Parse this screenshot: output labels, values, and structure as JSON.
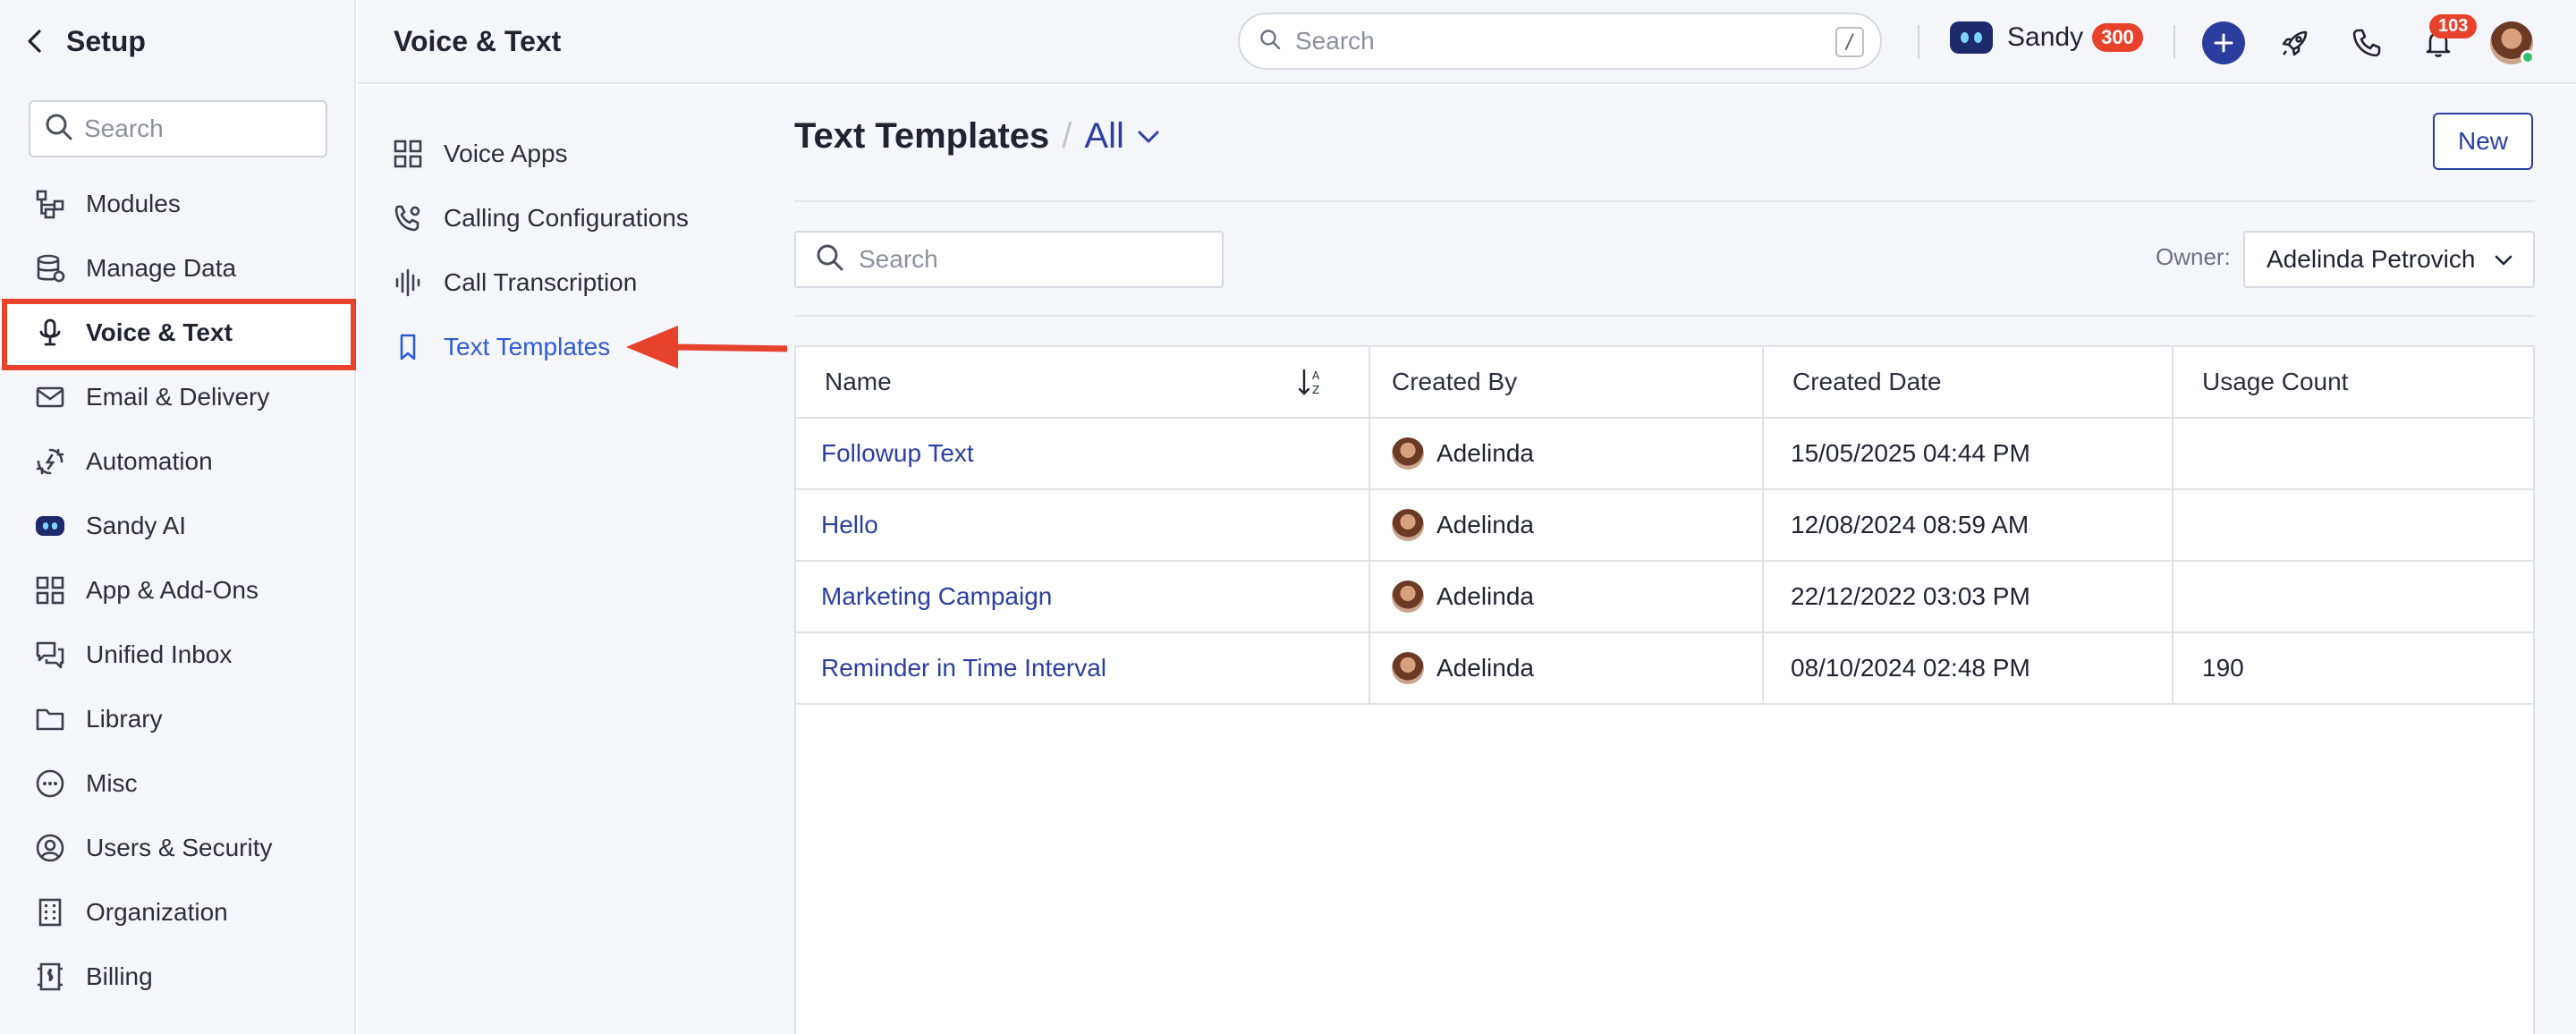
{
  "sidebar": {
    "title": "Setup",
    "search_placeholder": "Search",
    "items": [
      {
        "label": "Modules",
        "icon": "modules-icon"
      },
      {
        "label": "Manage Data",
        "icon": "database-icon"
      },
      {
        "label": "Voice & Text",
        "icon": "microphone-icon",
        "active": true
      },
      {
        "label": "Email & Delivery",
        "icon": "mail-icon"
      },
      {
        "label": "Automation",
        "icon": "automation-icon"
      },
      {
        "label": "Sandy AI",
        "icon": "bot-icon"
      },
      {
        "label": "App & Add-Ons",
        "icon": "grid-icon"
      },
      {
        "label": "Unified Inbox",
        "icon": "chat-icon"
      },
      {
        "label": "Library",
        "icon": "folder-icon"
      },
      {
        "label": "Misc",
        "icon": "ellipsis-icon"
      },
      {
        "label": "Users & Security",
        "icon": "user-circle-icon"
      },
      {
        "label": "Organization",
        "icon": "building-icon"
      },
      {
        "label": "Billing",
        "icon": "receipt-icon"
      }
    ]
  },
  "topbar": {
    "title": "Voice & Text",
    "search_placeholder": "Search",
    "search_shortcut": "/",
    "assistant_name": "Sandy",
    "assistant_credits": "300",
    "notification_count": "103"
  },
  "subnav": {
    "items": [
      {
        "label": "Voice Apps",
        "icon": "grid-icon"
      },
      {
        "label": "Calling Configurations",
        "icon": "phone-settings-icon"
      },
      {
        "label": "Call Transcription",
        "icon": "waveform-icon"
      },
      {
        "label": "Text Templates",
        "icon": "bookmark-icon",
        "active": true
      }
    ]
  },
  "main": {
    "title": "Text Templates",
    "separator": "/",
    "filter_value": "All",
    "new_label": "New",
    "search_placeholder": "Search",
    "owner_label": "Owner:",
    "owner_value": "Adelinda Petrovich",
    "table": {
      "columns": [
        "Name",
        "Created By",
        "Created Date",
        "Usage Count"
      ],
      "rows": [
        {
          "name": "Followup Text",
          "created_by": "Adelinda",
          "created_date": "15/05/2025 04:44 PM",
          "usage_count": ""
        },
        {
          "name": "Hello",
          "created_by": "Adelinda",
          "created_date": "12/08/2024 08:59 AM",
          "usage_count": ""
        },
        {
          "name": "Marketing Campaign",
          "created_by": "Adelinda",
          "created_date": "22/12/2022 03:03 PM",
          "usage_count": ""
        },
        {
          "name": "Reminder in Time Interval",
          "created_by": "Adelinda",
          "created_date": "08/10/2024 02:48 PM",
          "usage_count": "190"
        }
      ]
    }
  },
  "colors": {
    "accent": "#2a3fa1",
    "link": "#2f5bd6",
    "highlight": "#e8412c",
    "sidebar_bg": "#f5f6fa"
  }
}
